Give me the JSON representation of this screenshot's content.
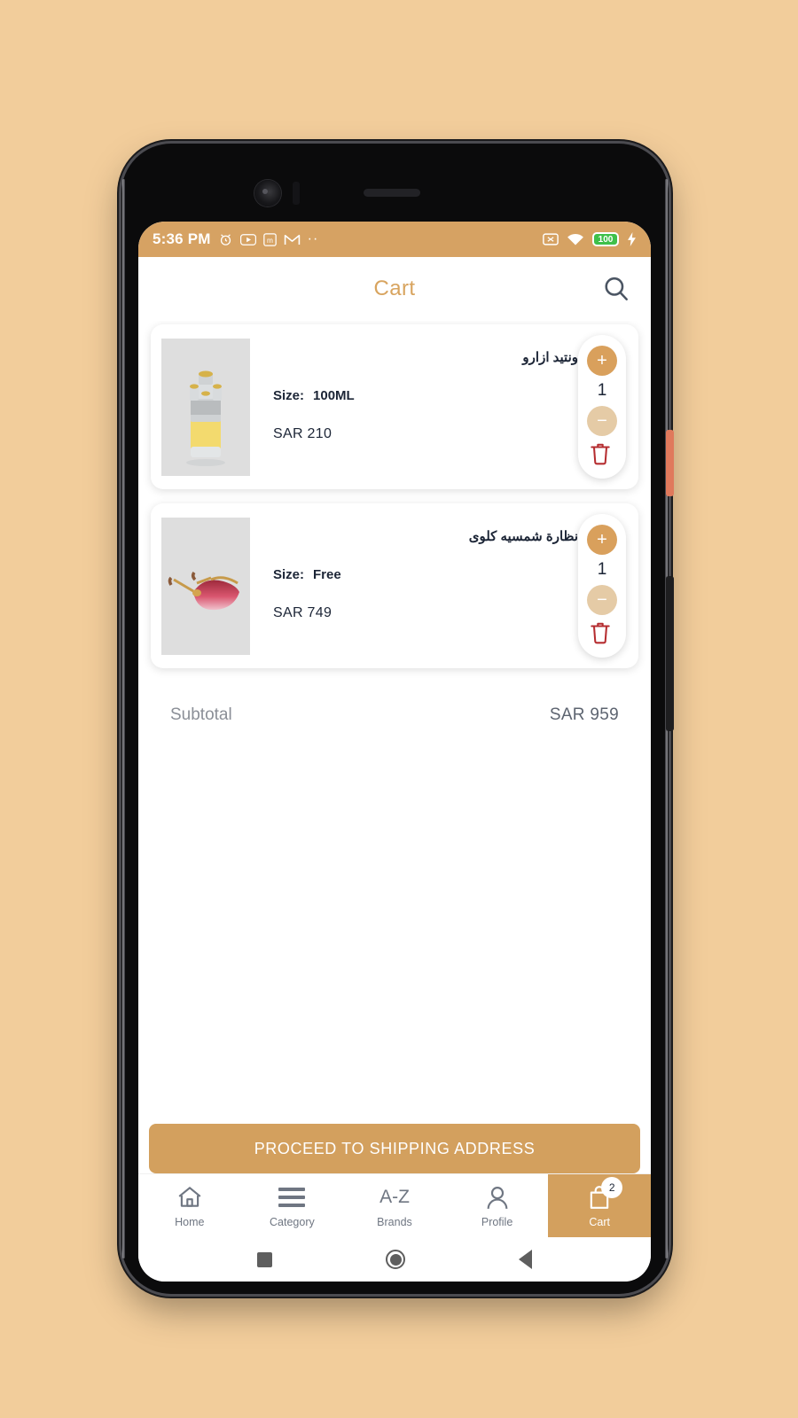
{
  "status_bar": {
    "time": "5:36 PM",
    "left_icons": [
      "alarm-icon",
      "youtube-icon",
      "m-app-icon",
      "gmail-icon",
      "more-dots-icon"
    ],
    "right_icons": [
      "no-sim-icon",
      "wifi-icon",
      "battery-icon",
      "charging-bolt-icon"
    ],
    "battery_level": "100",
    "more_dots": "··"
  },
  "header": {
    "title": "Cart",
    "search_icon": "search-icon",
    "title_color": "#d8a45f"
  },
  "cart": {
    "items": [
      {
        "name": "ونتيد ازارو",
        "size_label": "Size:",
        "size_value": "100ML",
        "price": "SAR 210",
        "quantity": "1",
        "image": "perfume-bottle",
        "plus_label": "+",
        "minus_label": "−"
      },
      {
        "name": "نظارة شمسيه كلوى",
        "size_label": "Size:",
        "size_value": "Free",
        "price": "SAR 749",
        "quantity": "1",
        "image": "sunglasses",
        "plus_label": "+",
        "minus_label": "−"
      }
    ]
  },
  "summary": {
    "subtotal_label": "Subtotal",
    "subtotal_value": "SAR 959"
  },
  "cta": {
    "proceed_label": "PROCEED TO SHIPPING ADDRESS",
    "color": "#d3a05e"
  },
  "bottom_nav": {
    "items": [
      {
        "label": "Home",
        "icon": "home-icon",
        "active": false
      },
      {
        "label": "Category",
        "icon": "category-icon",
        "active": false
      },
      {
        "label": "Brands",
        "icon": "a-z-icon",
        "active": false,
        "icon_text": "A-Z"
      },
      {
        "label": "Profile",
        "icon": "profile-icon",
        "active": false
      },
      {
        "label": "Cart",
        "icon": "cart-bag-icon",
        "active": true,
        "badge": "2"
      }
    ],
    "active_color": "#d3a05e",
    "inactive_color": "#6f7682"
  },
  "system_nav": {
    "recent_apps": "square-icon",
    "home": "circle-icon",
    "back": "triangle-back-icon"
  },
  "theme": {
    "page_background": "#f2cd9b",
    "accent": "#d3a05e",
    "status_bar": "#d6a263",
    "delete_red": "#b52d30"
  }
}
